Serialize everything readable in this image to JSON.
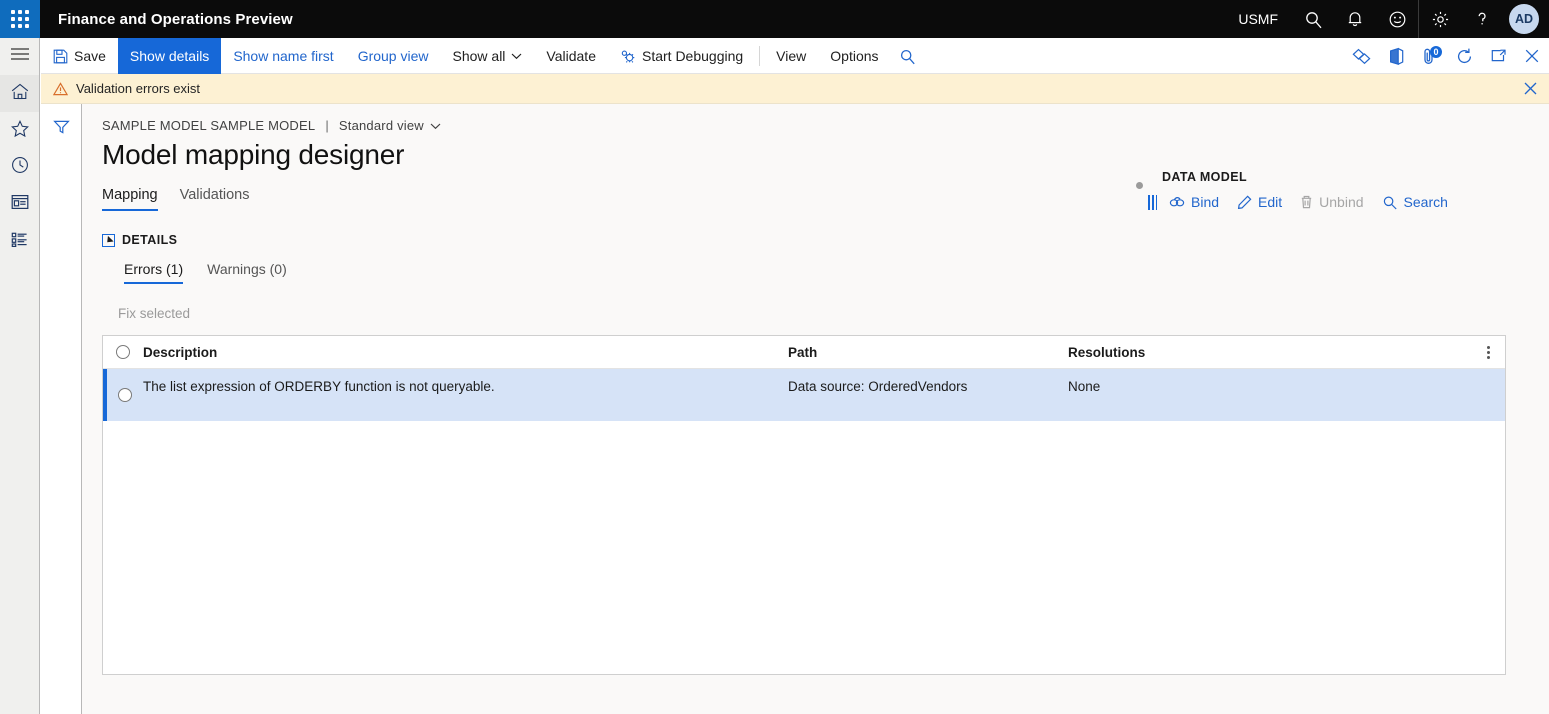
{
  "topbar": {
    "app_title": "Finance and Operations Preview",
    "company": "USMF",
    "waffle_icon": "app-launcher-icon",
    "search_icon": "search-icon",
    "notifications_icon": "bell-icon",
    "feedback_icon": "smiley-icon",
    "settings_icon": "gear-icon",
    "help_icon": "question-mark-icon",
    "avatar_initials": "AD"
  },
  "rail": {
    "items": [
      {
        "name": "hamburger-menu",
        "label": "Menu"
      },
      {
        "name": "home",
        "label": "Home"
      },
      {
        "name": "favorites",
        "label": "Favorites"
      },
      {
        "name": "recent",
        "label": "Recent"
      },
      {
        "name": "workspaces",
        "label": "Workspaces"
      },
      {
        "name": "modules",
        "label": "Modules"
      }
    ]
  },
  "commandbar": {
    "save": "Save",
    "show_details": "Show details",
    "show_name_first": "Show name first",
    "group_view": "Group view",
    "show_all": "Show all",
    "validate": "Validate",
    "start_debugging": "Start Debugging",
    "view": "View",
    "options": "Options",
    "search_icon": "search-icon",
    "right_icons": [
      {
        "name": "relationships-icon"
      },
      {
        "name": "office-icon"
      },
      {
        "name": "attachments-icon"
      },
      {
        "name": "refresh-icon"
      },
      {
        "name": "popout-icon"
      },
      {
        "name": "close-icon"
      }
    ],
    "attachments_badge": "0"
  },
  "message_bar": {
    "icon": "warning-triangle-icon",
    "text": "Validation errors exist",
    "close_icon": "close-icon",
    "background": "#fdf1d3"
  },
  "filter_rail": {
    "filter_icon": "filter-funnel-icon"
  },
  "page": {
    "breadcrumb_model": "SAMPLE MODEL SAMPLE MODEL",
    "breadcrumb_separator": "|",
    "breadcrumb_view": "Standard view",
    "title": "Model mapping designer",
    "tabs": [
      {
        "label": "Mapping",
        "selected": true
      },
      {
        "label": "Validations",
        "selected": false
      }
    ],
    "details_section": "DETAILS",
    "subtabs": [
      {
        "label": "Errors (1)",
        "selected": true
      },
      {
        "label": "Warnings (0)",
        "selected": false
      }
    ],
    "grid_toolbar": {
      "fix_selected": "Fix selected"
    },
    "grid": {
      "columns": [
        "Description",
        "Path",
        "Resolutions"
      ],
      "rows": [
        {
          "description": "The list expression of ORDERBY function is not queryable.",
          "path": "Data source: OrderedVendors",
          "resolutions": "None"
        }
      ],
      "kebab_icon": "more-options-icon"
    }
  },
  "data_model_panel": {
    "title": "DATA MODEL",
    "actions": [
      {
        "label": "Bind",
        "icon": "bind-link-icon",
        "disabled": false
      },
      {
        "label": "Edit",
        "icon": "pencil-icon",
        "disabled": false
      },
      {
        "label": "Unbind",
        "icon": "trash-icon",
        "disabled": true
      },
      {
        "label": "Search",
        "icon": "search-icon",
        "disabled": false
      }
    ]
  },
  "colors": {
    "accent": "#1668d8",
    "link": "#2266cc",
    "warning_bg": "#fdf1d3",
    "row_selected": "#d6e3f7",
    "topbar_bg": "#0b0b0b"
  }
}
